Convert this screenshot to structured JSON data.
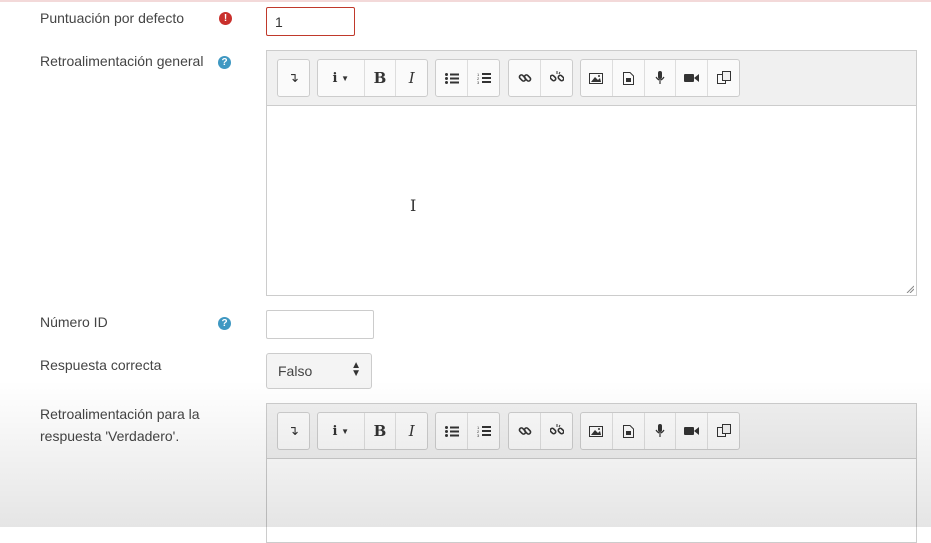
{
  "form": {
    "default_grade": {
      "label": "Puntuación por defecto",
      "value": "1",
      "error_icon": "exclamation-circle-icon"
    },
    "general_feedback": {
      "label": "Retroalimentación general",
      "help_icon": "question-circle-icon"
    },
    "id_number": {
      "label": "Número ID",
      "value": "",
      "help_icon": "question-circle-icon"
    },
    "correct_answer": {
      "label": "Respuesta correcta",
      "selected": "Falso"
    },
    "true_feedback": {
      "label_line1": "Retroalimentación para la",
      "label_line2": "respuesta 'Verdadero'."
    }
  },
  "toolbar": {
    "groups": [
      [
        "collapse-icon"
      ],
      [
        "paragraph-styles-icon",
        "bold-icon",
        "italic-icon"
      ],
      [
        "unordered-list-icon",
        "ordered-list-icon"
      ],
      [
        "link-icon",
        "unlink-icon"
      ],
      [
        "image-icon",
        "media-icon",
        "record-audio-icon",
        "record-video-icon",
        "manage-files-icon"
      ]
    ]
  },
  "colors": {
    "error": "#c9302c",
    "help": "#3f98c2",
    "toolbar_bg": "#f0f0f0",
    "invalid_border": "#c0392b"
  }
}
